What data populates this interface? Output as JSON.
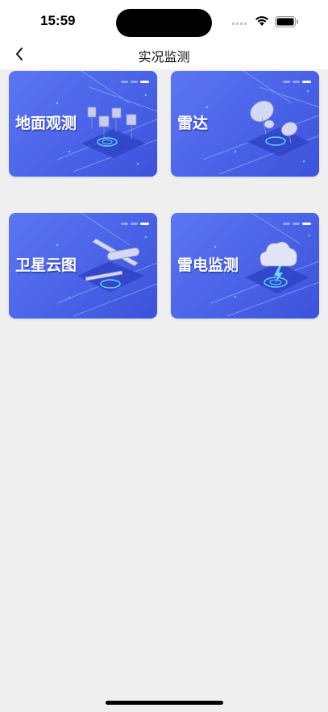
{
  "status": {
    "time": "15:59"
  },
  "nav": {
    "title": "实况监测"
  },
  "cards": [
    {
      "label": "地面观测"
    },
    {
      "label": "雷达"
    },
    {
      "label": "卫星云图"
    },
    {
      "label": "雷电监测"
    }
  ],
  "colors": {
    "card_bg": "#4d66ea",
    "page_bg": "#efeff0"
  },
  "icons": {
    "back": "chevron-left-icon",
    "wifi": "wifi-icon",
    "battery": "battery-icon"
  }
}
